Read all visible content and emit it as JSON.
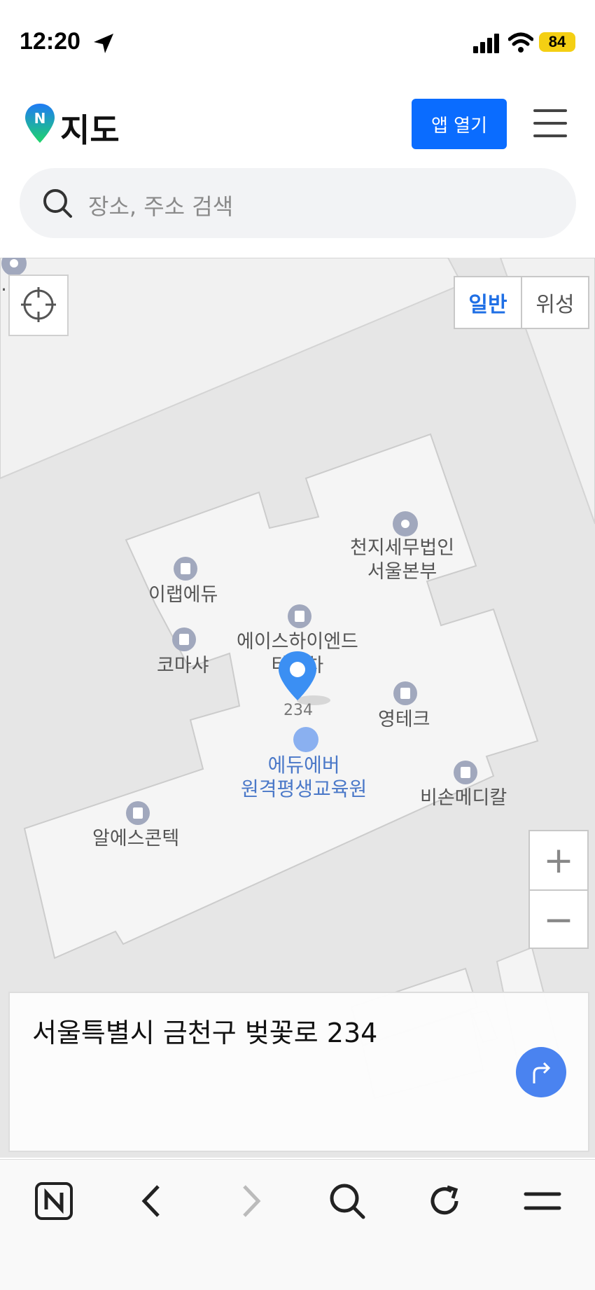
{
  "status_bar": {
    "time": "12:20",
    "battery": "84"
  },
  "header": {
    "title": "지도",
    "open_app_label": "앱 열기"
  },
  "search": {
    "placeholder": "장소, 주소 검색"
  },
  "map": {
    "type_toggle": {
      "general": "일반",
      "satellite": "위성"
    },
    "zoom_in": "+",
    "zoom_out": "−",
    "pois": {
      "cheonji": "천지세무법인\n서울본부",
      "ilab": "이랩에듀",
      "ace": "에이스하이엔드\n타워차",
      "komasha": "코마샤",
      "youngtech": "영테크",
      "eduever": "에듀에버\n원격평생교육원",
      "bison": "비손메디칼",
      "rs": "알에스콘텍",
      "pin_number": "234",
      "edge_label": "…센터"
    }
  },
  "card": {
    "address": "서울특별시 금천구 벚꽃로 234"
  }
}
